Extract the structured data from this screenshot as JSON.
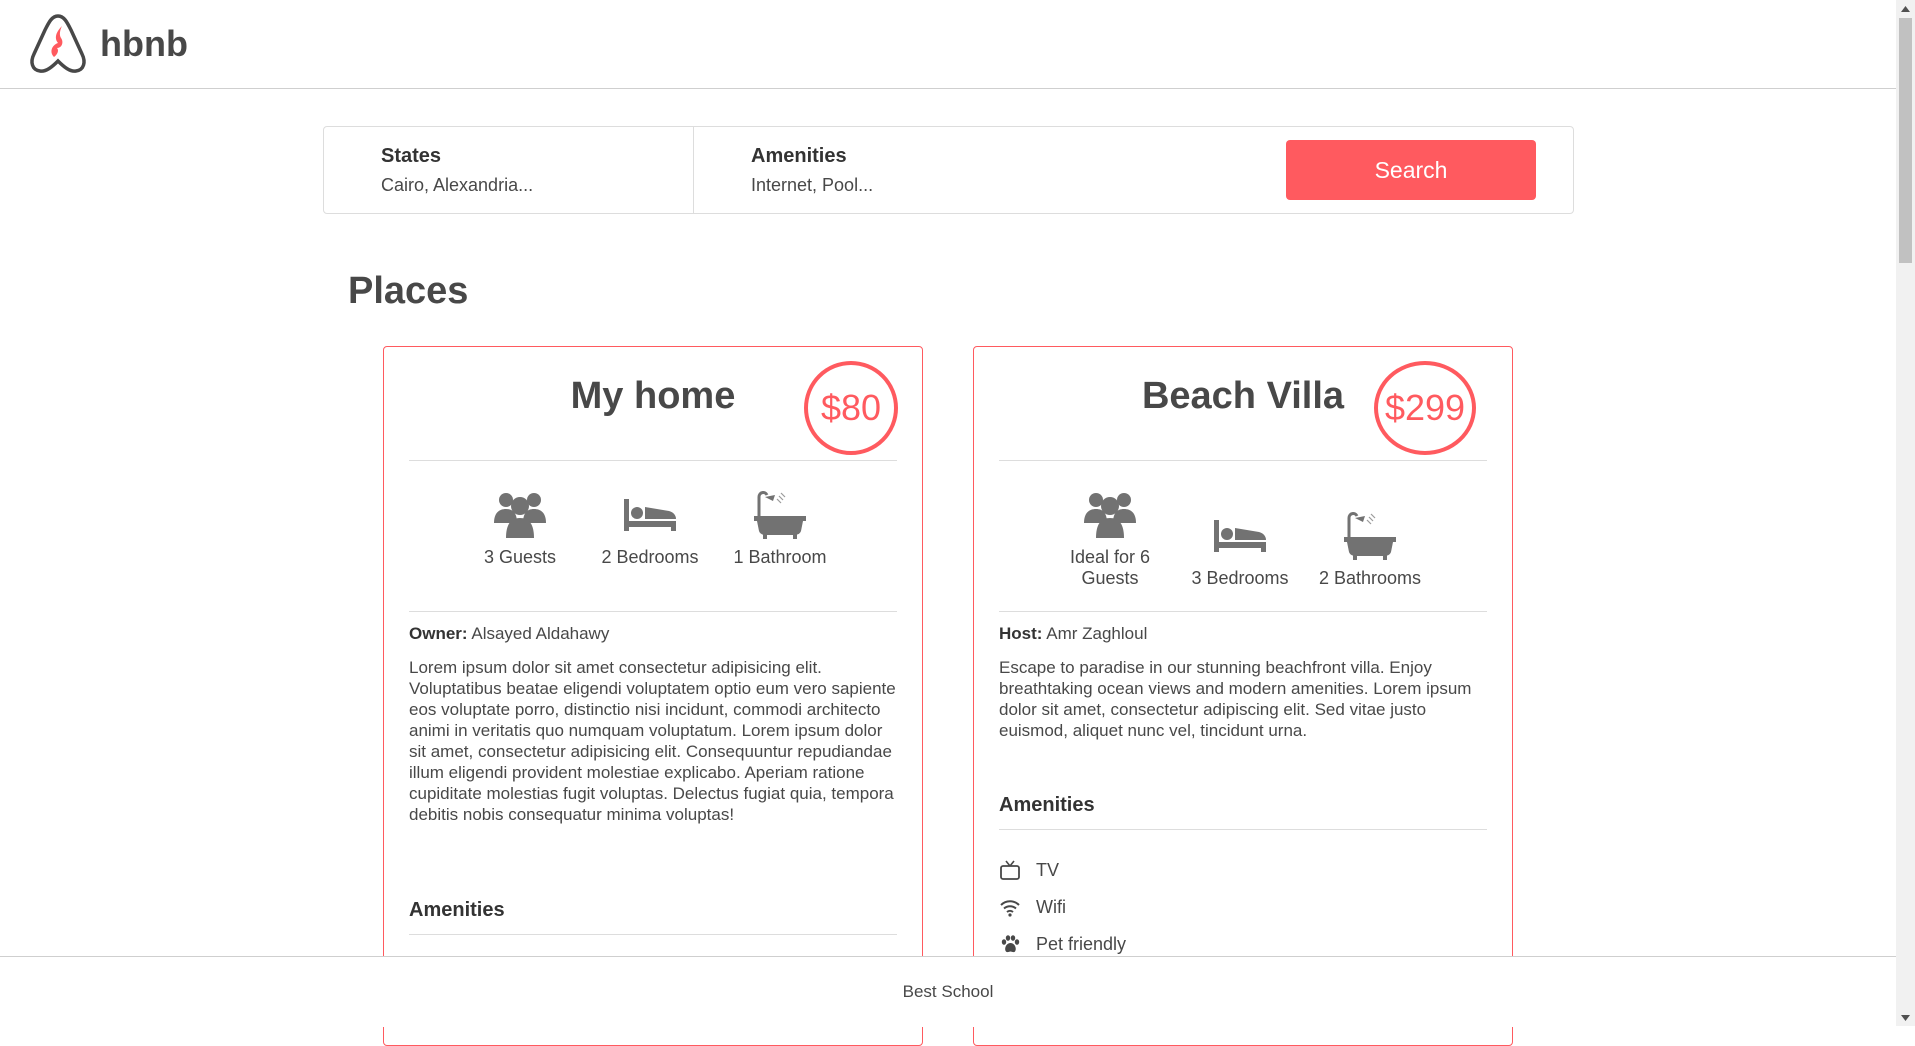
{
  "header": {
    "logo_text": "hbnb"
  },
  "filters": {
    "states": {
      "title": "States",
      "selection": "Cairo, Alexandria..."
    },
    "amenities": {
      "title": "Amenities",
      "selection": "Internet, Pool..."
    },
    "search_label": "Search"
  },
  "places": {
    "title": "Places",
    "items": [
      {
        "name": "My home",
        "price": "$80",
        "guests": "3 Guests",
        "bedrooms": "2 Bedrooms",
        "bathrooms": "1 Bathroom",
        "person_label": "Owner:",
        "person_name": "Alsayed Aldahawy",
        "description": "Lorem ipsum dolor sit amet consectetur adipisicing elit. Voluptatibus beatae eligendi voluptatem optio eum vero sapiente eos voluptate porro, distinctio nisi incidunt, commodi architecto animi in veritatis quo numquam voluptatum. Lorem ipsum dolor sit amet, consectetur adipisicing elit. Consequuntur repudiandae illum eligendi provident molestiae explicabo. Aperiam ratione cupiditate molestias fugit voluptas. Delectus fugiat quia, tempora debitis nobis consequatur minima voluptas!",
        "amenities_title": "Amenities"
      },
      {
        "name": "Beach Villa",
        "price": "$299",
        "guests": "Ideal for 6 Guests",
        "bedrooms": "3 Bedrooms",
        "bathrooms": "2 Bathrooms",
        "person_label": "Host:",
        "person_name": "Amr Zaghloul",
        "description": "Escape to paradise in our stunning beachfront villa. Enjoy breathtaking ocean views and modern amenities. Lorem ipsum dolor sit amet, consectetur adipiscing elit. Sed vitae justo euismod, aliquet nunc vel, tincidunt urna.",
        "amenities_title": "Amenities",
        "amenities": [
          {
            "label": "TV",
            "icon": "tv-icon"
          },
          {
            "label": "Wifi",
            "icon": "wifi-icon"
          },
          {
            "label": "Pet friendly",
            "icon": "paw-icon"
          }
        ]
      }
    ]
  },
  "footer": {
    "text": "Best School"
  },
  "colors": {
    "accent": "#ff5a5f",
    "text": "#484848",
    "border": "#dddddd"
  }
}
